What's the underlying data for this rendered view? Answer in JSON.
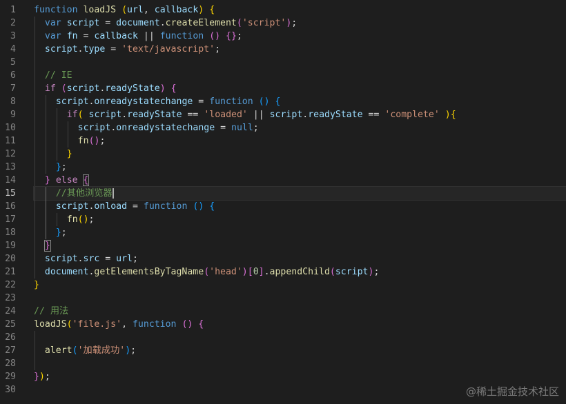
{
  "editor": {
    "theme_colors": {
      "background": "#1e1e1e",
      "keyword": "#569cd6",
      "control": "#c586c0",
      "function": "#dcdcaa",
      "variable": "#9cdcfe",
      "string": "#ce9178",
      "number": "#b5cea8",
      "comment": "#6a9955",
      "bracket_level_1": "#ffd700",
      "bracket_level_2": "#da70d6",
      "bracket_level_3": "#179fff"
    },
    "current_line": 15,
    "lines": [
      {
        "n": "1",
        "indent": 0,
        "tokens": [
          [
            "kw",
            "function"
          ],
          [
            "pl",
            " "
          ],
          [
            "fn",
            "loadJS"
          ],
          [
            "pl",
            " "
          ],
          [
            "b1",
            "("
          ],
          [
            "var",
            "url"
          ],
          [
            "pl",
            ", "
          ],
          [
            "var",
            "callback"
          ],
          [
            "b1",
            ")"
          ],
          [
            "pl",
            " "
          ],
          [
            "b1",
            "{"
          ]
        ]
      },
      {
        "n": "2",
        "indent": 1,
        "tokens": [
          [
            "kw",
            "var"
          ],
          [
            "pl",
            " "
          ],
          [
            "var",
            "script"
          ],
          [
            "pl",
            " = "
          ],
          [
            "var",
            "document"
          ],
          [
            "pl",
            "."
          ],
          [
            "fn",
            "createElement"
          ],
          [
            "b2",
            "("
          ],
          [
            "str",
            "'script'"
          ],
          [
            "b2",
            ")"
          ],
          [
            "pl",
            ";"
          ]
        ]
      },
      {
        "n": "3",
        "indent": 1,
        "tokens": [
          [
            "kw",
            "var"
          ],
          [
            "pl",
            " "
          ],
          [
            "var",
            "fn"
          ],
          [
            "pl",
            " = "
          ],
          [
            "var",
            "callback"
          ],
          [
            "pl",
            " || "
          ],
          [
            "kw",
            "function"
          ],
          [
            "pl",
            " "
          ],
          [
            "b2",
            "()"
          ],
          [
            "pl",
            " "
          ],
          [
            "b2",
            "{}"
          ],
          [
            "pl",
            ";"
          ]
        ]
      },
      {
        "n": "4",
        "indent": 1,
        "tokens": [
          [
            "var",
            "script"
          ],
          [
            "pl",
            "."
          ],
          [
            "var",
            "type"
          ],
          [
            "pl",
            " = "
          ],
          [
            "str",
            "'text/javascript'"
          ],
          [
            "pl",
            ";"
          ]
        ]
      },
      {
        "n": "5",
        "indent": 1,
        "tokens": []
      },
      {
        "n": "6",
        "indent": 1,
        "tokens": [
          [
            "com",
            "// IE"
          ]
        ]
      },
      {
        "n": "7",
        "indent": 1,
        "tokens": [
          [
            "ctl",
            "if"
          ],
          [
            "pl",
            " "
          ],
          [
            "b2",
            "("
          ],
          [
            "var",
            "script"
          ],
          [
            "pl",
            "."
          ],
          [
            "var",
            "readyState"
          ],
          [
            "b2",
            ")"
          ],
          [
            "pl",
            " "
          ],
          [
            "b2",
            "{"
          ]
        ]
      },
      {
        "n": "8",
        "indent": 2,
        "tokens": [
          [
            "var",
            "script"
          ],
          [
            "pl",
            "."
          ],
          [
            "var",
            "onreadystatechange"
          ],
          [
            "pl",
            " = "
          ],
          [
            "kw",
            "function"
          ],
          [
            "pl",
            " "
          ],
          [
            "b3",
            "()"
          ],
          [
            "pl",
            " "
          ],
          [
            "b3",
            "{"
          ]
        ]
      },
      {
        "n": "9",
        "indent": 3,
        "tokens": [
          [
            "ctl",
            "if"
          ],
          [
            "b1",
            "("
          ],
          [
            "pl",
            " "
          ],
          [
            "var",
            "script"
          ],
          [
            "pl",
            "."
          ],
          [
            "var",
            "readyState"
          ],
          [
            "pl",
            " == "
          ],
          [
            "str",
            "'loaded'"
          ],
          [
            "pl",
            " || "
          ],
          [
            "var",
            "script"
          ],
          [
            "pl",
            "."
          ],
          [
            "var",
            "readyState"
          ],
          [
            "pl",
            " == "
          ],
          [
            "str",
            "'complete'"
          ],
          [
            "pl",
            " "
          ],
          [
            "b1",
            ")"
          ],
          [
            "b1",
            "{"
          ]
        ]
      },
      {
        "n": "10",
        "indent": 4,
        "tokens": [
          [
            "var",
            "script"
          ],
          [
            "pl",
            "."
          ],
          [
            "var",
            "onreadystatechange"
          ],
          [
            "pl",
            " = "
          ],
          [
            "kw",
            "null"
          ],
          [
            "pl",
            ";"
          ]
        ]
      },
      {
        "n": "11",
        "indent": 4,
        "tokens": [
          [
            "fn",
            "fn"
          ],
          [
            "b2",
            "()"
          ],
          [
            "pl",
            ";"
          ]
        ]
      },
      {
        "n": "12",
        "indent": 3,
        "tokens": [
          [
            "b1",
            "}"
          ]
        ]
      },
      {
        "n": "13",
        "indent": 2,
        "tokens": [
          [
            "b3",
            "}"
          ],
          [
            "pl",
            ";"
          ]
        ]
      },
      {
        "n": "14",
        "indent": 1,
        "tokens": [
          [
            "b2",
            "}"
          ],
          [
            "pl",
            " "
          ],
          [
            "ctl",
            "else"
          ],
          [
            "pl",
            " "
          ],
          [
            "b2m",
            "{"
          ]
        ]
      },
      {
        "n": "15",
        "indent": 2,
        "tokens": [
          [
            "com",
            "//其他浏览器"
          ]
        ]
      },
      {
        "n": "16",
        "indent": 2,
        "tokens": [
          [
            "var",
            "script"
          ],
          [
            "pl",
            "."
          ],
          [
            "var",
            "onload"
          ],
          [
            "pl",
            " = "
          ],
          [
            "kw",
            "function"
          ],
          [
            "pl",
            " "
          ],
          [
            "b3",
            "()"
          ],
          [
            "pl",
            " "
          ],
          [
            "b3",
            "{"
          ]
        ]
      },
      {
        "n": "17",
        "indent": 3,
        "tokens": [
          [
            "fn",
            "fn"
          ],
          [
            "b1",
            "()"
          ],
          [
            "pl",
            ";"
          ]
        ]
      },
      {
        "n": "18",
        "indent": 2,
        "tokens": [
          [
            "b3",
            "}"
          ],
          [
            "pl",
            ";"
          ]
        ]
      },
      {
        "n": "19",
        "indent": 1,
        "tokens": [
          [
            "b2m",
            "}"
          ]
        ]
      },
      {
        "n": "20",
        "indent": 1,
        "tokens": [
          [
            "var",
            "script"
          ],
          [
            "pl",
            "."
          ],
          [
            "var",
            "src"
          ],
          [
            "pl",
            " = "
          ],
          [
            "var",
            "url"
          ],
          [
            "pl",
            ";"
          ]
        ]
      },
      {
        "n": "21",
        "indent": 1,
        "tokens": [
          [
            "var",
            "document"
          ],
          [
            "pl",
            "."
          ],
          [
            "fn",
            "getElementsByTagName"
          ],
          [
            "b2",
            "("
          ],
          [
            "str",
            "'head'"
          ],
          [
            "b2",
            ")"
          ],
          [
            "b2",
            "["
          ],
          [
            "num",
            "0"
          ],
          [
            "b2",
            "]"
          ],
          [
            "pl",
            "."
          ],
          [
            "fn",
            "appendChild"
          ],
          [
            "b2",
            "("
          ],
          [
            "var",
            "script"
          ],
          [
            "b2",
            ")"
          ],
          [
            "pl",
            ";"
          ]
        ]
      },
      {
        "n": "22",
        "indent": 0,
        "tokens": [
          [
            "b1",
            "}"
          ]
        ]
      },
      {
        "n": "23",
        "indent": 0,
        "tokens": []
      },
      {
        "n": "24",
        "indent": 0,
        "tokens": [
          [
            "com",
            "// 用法"
          ]
        ]
      },
      {
        "n": "25",
        "indent": 0,
        "tokens": [
          [
            "fn",
            "loadJS"
          ],
          [
            "b1",
            "("
          ],
          [
            "str",
            "'file.js'"
          ],
          [
            "pl",
            ", "
          ],
          [
            "kw",
            "function"
          ],
          [
            "pl",
            " "
          ],
          [
            "b2",
            "()"
          ],
          [
            "pl",
            " "
          ],
          [
            "b2",
            "{"
          ]
        ]
      },
      {
        "n": "26",
        "indent": 1,
        "tokens": []
      },
      {
        "n": "27",
        "indent": 1,
        "tokens": [
          [
            "fn",
            "alert"
          ],
          [
            "b3",
            "("
          ],
          [
            "str",
            "'加载成功'"
          ],
          [
            "b3",
            ")"
          ],
          [
            "pl",
            ";"
          ]
        ]
      },
      {
        "n": "28",
        "indent": 1,
        "tokens": []
      },
      {
        "n": "29",
        "indent": 0,
        "tokens": [
          [
            "b2",
            "}"
          ],
          [
            "b1",
            ")"
          ],
          [
            "pl",
            ";"
          ]
        ]
      },
      {
        "n": "30",
        "indent": 0,
        "tokens": []
      }
    ]
  },
  "watermark": "@稀土掘金技术社区"
}
